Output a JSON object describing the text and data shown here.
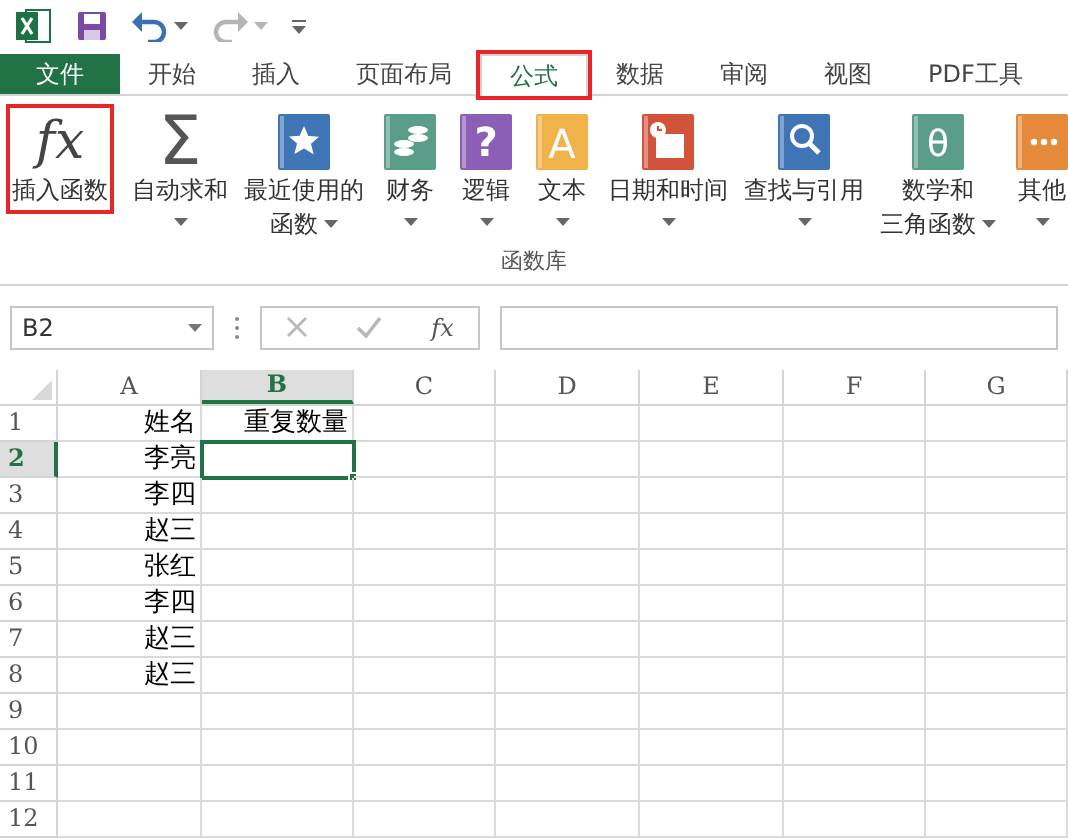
{
  "quick_access": {
    "undo_disabled": false,
    "redo_disabled": true
  },
  "tabs": [
    {
      "label": "文件",
      "kind": "file",
      "selected": false,
      "highlighted": false
    },
    {
      "label": "开始",
      "kind": "tab",
      "selected": false,
      "highlighted": false
    },
    {
      "label": "插入",
      "kind": "tab",
      "selected": false,
      "highlighted": false
    },
    {
      "label": "页面布局",
      "kind": "tab",
      "selected": false,
      "highlighted": false
    },
    {
      "label": "公式",
      "kind": "tab",
      "selected": true,
      "highlighted": true
    },
    {
      "label": "数据",
      "kind": "tab",
      "selected": false,
      "highlighted": false
    },
    {
      "label": "审阅",
      "kind": "tab",
      "selected": false,
      "highlighted": false
    },
    {
      "label": "视图",
      "kind": "tab",
      "selected": false,
      "highlighted": false
    },
    {
      "label": "PDF工具",
      "kind": "tab",
      "selected": false,
      "highlighted": false
    }
  ],
  "ribbon": {
    "group_label": "函数库",
    "buttons": [
      {
        "kind": "fx",
        "glyph": "fx",
        "lines": [
          "插入函数"
        ],
        "dropdown": false,
        "highlighted": true
      },
      {
        "kind": "sigma",
        "glyph": "Σ",
        "lines": [
          "自动求和"
        ],
        "dropdown": true,
        "highlighted": false
      },
      {
        "kind": "star",
        "lines": [
          "最近使用的",
          "函数"
        ],
        "dropdown": true,
        "highlighted": false
      },
      {
        "kind": "coins",
        "lines": [
          "财务"
        ],
        "dropdown": true,
        "highlighted": false
      },
      {
        "kind": "question",
        "glyph": "?",
        "lines": [
          "逻辑"
        ],
        "dropdown": true,
        "highlighted": false
      },
      {
        "kind": "letter",
        "glyph": "A",
        "lines": [
          "文本"
        ],
        "dropdown": true,
        "highlighted": false
      },
      {
        "kind": "calendar",
        "lines": [
          "日期和时间"
        ],
        "dropdown": true,
        "highlighted": false
      },
      {
        "kind": "magnifier",
        "lines": [
          "查找与引用"
        ],
        "dropdown": true,
        "highlighted": false
      },
      {
        "kind": "theta",
        "glyph": "θ",
        "lines": [
          "数学和",
          "三角函数"
        ],
        "dropdown": true,
        "highlighted": false
      },
      {
        "kind": "dots",
        "lines": [
          "其他"
        ],
        "dropdown": true,
        "highlighted": false
      }
    ]
  },
  "formula_bar": {
    "name_box": "B2",
    "function_glyph": "fx"
  },
  "grid": {
    "columns": [
      {
        "label": "A",
        "selected": false
      },
      {
        "label": "B",
        "selected": true
      },
      {
        "label": "C",
        "selected": false
      },
      {
        "label": "D",
        "selected": false
      },
      {
        "label": "E",
        "selected": false
      },
      {
        "label": "F",
        "selected": false
      },
      {
        "label": "G",
        "selected": false
      }
    ],
    "rows": [
      {
        "label": "1",
        "selected": false,
        "cells": [
          {
            "text": "姓名",
            "active": false
          },
          {
            "text": "重复数量",
            "active": false
          }
        ]
      },
      {
        "label": "2",
        "selected": true,
        "cells": [
          {
            "text": "李亮",
            "active": false
          },
          {
            "active": true
          }
        ]
      },
      {
        "label": "3",
        "selected": false,
        "cells": [
          {
            "text": "李四",
            "active": false
          },
          {
            "active": false
          }
        ]
      },
      {
        "label": "4",
        "selected": false,
        "cells": [
          {
            "text": "赵三",
            "active": false
          },
          {
            "active": false
          }
        ]
      },
      {
        "label": "5",
        "selected": false,
        "cells": [
          {
            "text": "张红",
            "active": false
          },
          {
            "active": false
          }
        ]
      },
      {
        "label": "6",
        "selected": false,
        "cells": [
          {
            "text": "李四",
            "active": false
          },
          {
            "active": false
          }
        ]
      },
      {
        "label": "7",
        "selected": false,
        "cells": [
          {
            "text": "赵三",
            "active": false
          },
          {
            "active": false
          }
        ]
      },
      {
        "label": "8",
        "selected": false,
        "cells": [
          {
            "text": "赵三",
            "active": false
          },
          {
            "active": false
          }
        ]
      },
      {
        "label": "9",
        "selected": false,
        "cells": [
          {
            "active": false
          },
          {
            "active": false
          }
        ]
      },
      {
        "label": "10",
        "selected": false,
        "cells": [
          {
            "active": false
          },
          {
            "active": false
          }
        ]
      },
      {
        "label": "11",
        "selected": false,
        "cells": [
          {
            "active": false
          },
          {
            "active": false
          }
        ]
      },
      {
        "label": "12",
        "selected": false,
        "cells": [
          {
            "active": false
          },
          {
            "active": false
          }
        ]
      }
    ]
  }
}
